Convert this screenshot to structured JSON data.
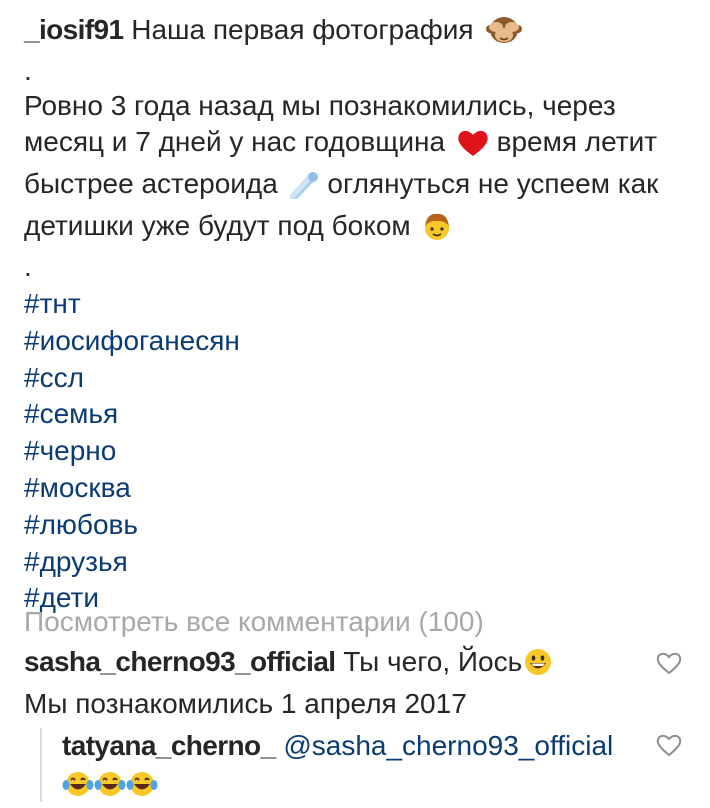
{
  "post": {
    "username": "_iosif91",
    "title": "Наша первая фотография",
    "title_emoji": "see-no-evil-monkey",
    "dot1": ".",
    "body_lines": [
      "Ровно 3 года назад мы познакомились, через",
      "месяц и 7 дней у нас годовщина",
      "время летит",
      "быстрее астероида",
      "оглянуться не успеем как",
      "детишки уже будут под боком"
    ],
    "dot2": ".",
    "hashtags": [
      "#тнт",
      "#иосифоганесян",
      "#ссл",
      "#семья",
      "#черно",
      "#москва",
      "#любовь",
      "#друзья",
      "#дети"
    ],
    "view_all_comments": "Посмотреть все комментарии (100)"
  },
  "comments": [
    {
      "username": "sasha_cherno93_official",
      "text": "Ты чего, Йось",
      "emoji": "grinning-face",
      "text_line2": "Мы познакомились 1 апреля 2017"
    },
    {
      "username": "tatyana_cherno_",
      "mention": "@sasha_cherno93_official",
      "emojis": [
        "tears-of-joy",
        "tears-of-joy",
        "tears-of-joy"
      ]
    }
  ],
  "colors": {
    "text": "#262626",
    "hashtag": "#0b3b73",
    "muted": "#a8a8a8",
    "heart_outline": "#8e8e8e",
    "emoji_face": "#f8c82b",
    "red_heart": "#e0131b",
    "comet": "#8fc0ea"
  }
}
